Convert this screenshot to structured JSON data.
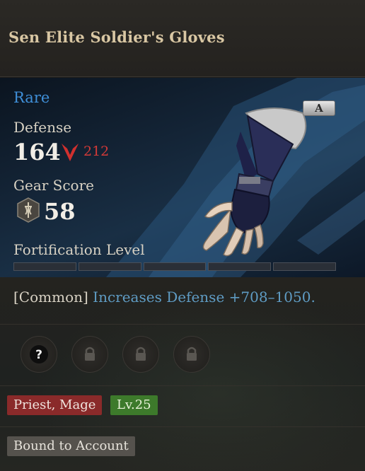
{
  "item": {
    "title": "Sen Elite Soldier's Gloves",
    "rarity": "Rare",
    "grade": "A",
    "rarity_color": "#3f8fd8"
  },
  "stats": {
    "defense_label": "Defense",
    "defense_value": "164",
    "defense_compare": "212",
    "compare_direction": "down",
    "gear_score_label": "Gear Score",
    "gear_score_value": "58"
  },
  "fortification": {
    "label": "Fortification Level",
    "filled": 0,
    "total": 5
  },
  "effect": {
    "tag": "[Common]",
    "text": "Increases Defense +708–1050."
  },
  "sockets": [
    {
      "state": "unknown",
      "icon": "question-icon"
    },
    {
      "state": "locked",
      "icon": "lock-icon"
    },
    {
      "state": "locked",
      "icon": "lock-icon"
    },
    {
      "state": "locked",
      "icon": "lock-icon"
    }
  ],
  "requirements": {
    "classes": "Priest, Mage",
    "level": "Lv.25"
  },
  "binding": "Bound to Account"
}
